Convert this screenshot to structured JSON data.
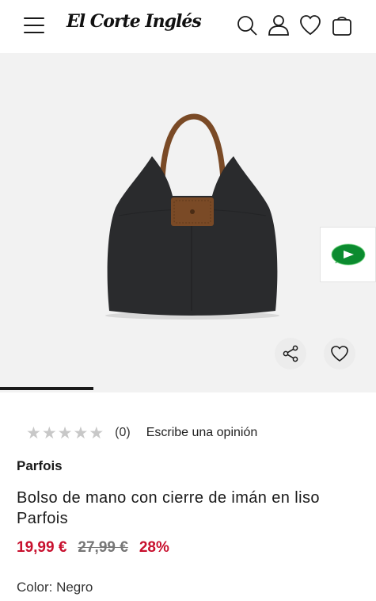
{
  "header": {
    "logo_text": "El Corte Inglés",
    "icons": [
      "menu-icon",
      "search-icon",
      "user-icon",
      "heart-icon",
      "bag-icon"
    ]
  },
  "gallery": {
    "progress_fraction": 0.25,
    "side_button_icon": "play-icon",
    "accent_green": "#0b8b2f"
  },
  "rating": {
    "stars_total": 5,
    "stars_filled": 0,
    "count": "(0)",
    "write_review": "Escribe una opinión"
  },
  "product": {
    "brand": "Parfois",
    "title": "Bolso de mano con cierre de imán en liso Parfois",
    "price_current": "19,99 €",
    "price_original": "27,99 €",
    "discount": "28%",
    "color_label": "Color: Negro"
  },
  "colors": {
    "sale": "#c8102e",
    "bag_body": "#2a2b2d",
    "bag_leather": "#7a4a26"
  }
}
